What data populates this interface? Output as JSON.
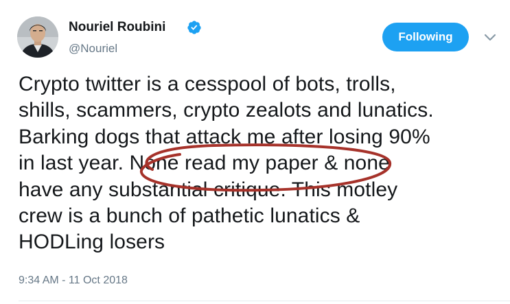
{
  "author": {
    "display_name": "Nouriel Roubini",
    "handle": "@Nouriel",
    "verified": true,
    "avatar_icon": "profile-photo"
  },
  "actions": {
    "follow_label": "Following",
    "follow_color": "#1da1f2",
    "more_icon": "chevron-down-icon"
  },
  "tweet": {
    "lines": [
      "Crypto twitter is a cesspool of bots, trolls,",
      "shills, scammers, crypto zealots and lunatics.",
      "Barking dogs that attack me after losing 90%",
      "in last year. None read my paper & none",
      "have any substantial critique. This motley",
      "crew is a bunch of pathetic lunatics &",
      "HODLing losers"
    ],
    "annotation_color": "#a6322a",
    "timestamp": "9:34 AM - 11 Oct 2018"
  },
  "colors": {
    "text": "#14171a",
    "secondary_text": "#657786",
    "verified_badge": "#1da1f2",
    "divider": "#e6ecf0"
  }
}
